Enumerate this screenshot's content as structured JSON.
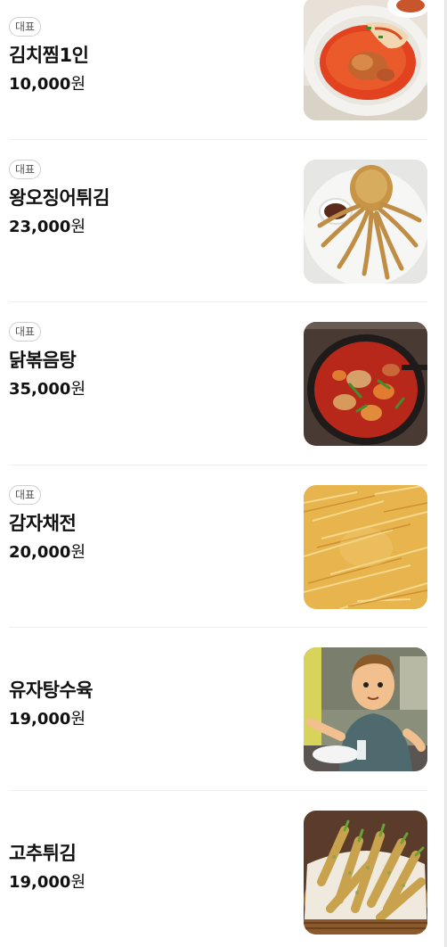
{
  "menu": {
    "items": [
      {
        "badge": "대표",
        "name": "김치찜1인",
        "price": "10,000",
        "unit": "원",
        "image": "kimchi-jjim-photo"
      },
      {
        "badge": "대표",
        "name": "왕오징어튀김",
        "price": "23,000",
        "unit": "원",
        "image": "fried-squid-photo"
      },
      {
        "badge": "대표",
        "name": "닭볶음탕",
        "price": "35,000",
        "unit": "원",
        "image": "braised-chicken-photo"
      },
      {
        "badge": "대표",
        "name": "감자채전",
        "price": "20,000",
        "unit": "원",
        "image": "potato-pancake-photo"
      },
      {
        "badge": "",
        "name": "유자탕수육",
        "price": "19,000",
        "unit": "원",
        "image": "cartoon-character-photo"
      },
      {
        "badge": "",
        "name": "고추튀김",
        "price": "19,000",
        "unit": "원",
        "image": "fried-pepper-photo"
      }
    ]
  },
  "colors": {
    "divider": "#eeeeee",
    "badge_border": "#cfcfcf",
    "text": "#111111"
  }
}
